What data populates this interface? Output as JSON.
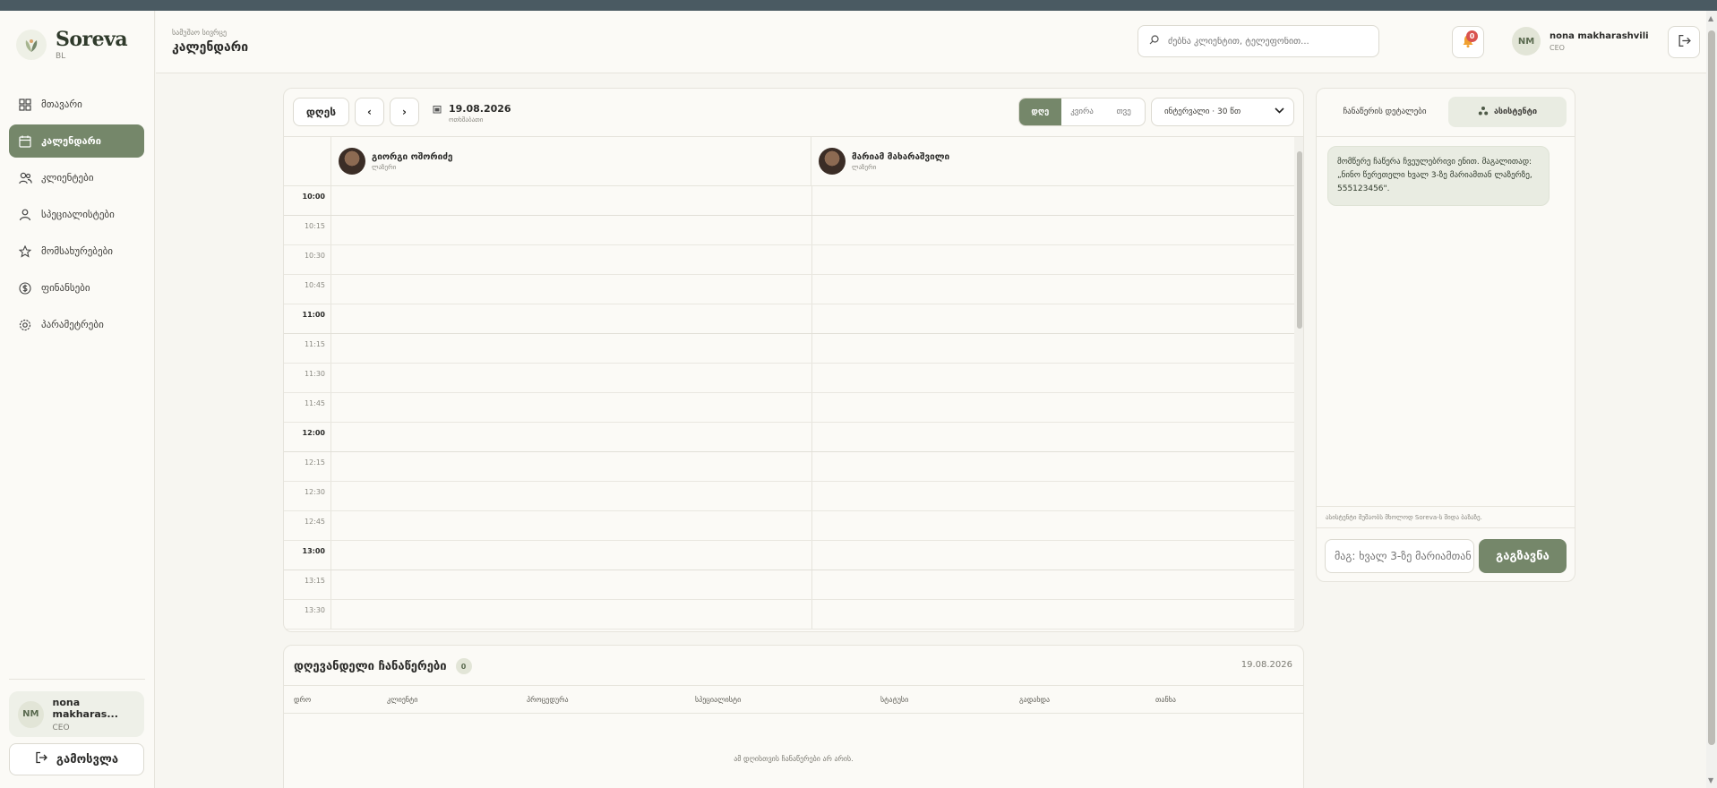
{
  "app": {
    "name": "Soreva",
    "sub": "BL"
  },
  "sidebar": {
    "items": [
      {
        "label": "მთავარი",
        "icon": "dashboard-grid-icon",
        "name": "sidebar-item-home"
      },
      {
        "label": "კალენდარი",
        "icon": "calendar-icon",
        "name": "sidebar-item-calendar",
        "active": true
      },
      {
        "label": "კლიენტები",
        "icon": "users-icon",
        "name": "sidebar-item-clients"
      },
      {
        "label": "სპეციალისტები",
        "icon": "user-icon",
        "name": "sidebar-item-specialists"
      },
      {
        "label": "მომსახურებები",
        "icon": "star-icon",
        "name": "sidebar-item-services"
      },
      {
        "label": "ფინანსები",
        "icon": "dollar-icon",
        "name": "sidebar-item-finances"
      },
      {
        "label": "პარამეტრები",
        "icon": "gear-icon",
        "name": "sidebar-item-settings"
      }
    ],
    "user": {
      "initials": "NM",
      "name": "nona makharas...",
      "role": "CEO"
    },
    "logout_label": "გამოსვლა"
  },
  "header": {
    "crumb": "სამუშაო სივრცე",
    "title": "კალენდარი",
    "search_placeholder": "ძებნა კლიენტით, ტელეფონით...",
    "notifications_count": "0",
    "user": {
      "initials": "NM",
      "name": "nona makharashvili",
      "role": "CEO"
    }
  },
  "calendar": {
    "today_label": "დღეს",
    "prev_label": "‹",
    "next_label": "›",
    "date": "19.08.2026",
    "weekday": "ოთხშაბათი",
    "views": [
      {
        "label": "დღე",
        "active": true
      },
      {
        "label": "კვირა",
        "active": false
      },
      {
        "label": "თვე",
        "active": false
      }
    ],
    "interval_label": "ინტერვალი · 30 წთ",
    "staff": [
      {
        "name": "გიორგი ოშორიძე",
        "role": "ლაზერი"
      },
      {
        "name": "მარიამ მახარაშვილი",
        "role": "ლაზერი"
      }
    ],
    "times": [
      "10:00",
      "10:15",
      "10:30",
      "10:45",
      "11:00",
      "11:15",
      "11:30",
      "11:45",
      "12:00",
      "12:15",
      "12:30",
      "12:45",
      "13:00",
      "13:15",
      "13:30"
    ]
  },
  "assistant": {
    "tabs": [
      {
        "label": "ჩანაწერის დეტალები",
        "active": false
      },
      {
        "label": "ასისტენტი",
        "active": true
      }
    ],
    "message": "მომწერე ჩაწერა ჩვეულებრივი ენით. მაგალითად: „ნინო წერეთელი ხვალ 3-ზე მარიამთან ლაზერზე, 555123456\".",
    "note": "ასისტენტი მუშაობს მხოლოდ Soreva-ს შიდა ბაზაზე.",
    "input_placeholder": "მაგ: ხვალ 3-ზე მარიამთან",
    "send_label": "გაგზავნა"
  },
  "appointments": {
    "title": "დღევანდელი ჩანაწერები",
    "count": "0",
    "date": "19.08.2026",
    "columns": [
      "დრო",
      "კლიენტი",
      "პროცედურა",
      "სპეციალისტი",
      "სტატუსი",
      "გადახდა",
      "თანხა"
    ],
    "empty_text": "ამ დღისთვის ჩანაწერები არ არის."
  },
  "colors": {
    "accent": "#75876a",
    "accent_light": "#e9ece2",
    "background": "#f7f6f1",
    "badge": "#d9534f"
  }
}
